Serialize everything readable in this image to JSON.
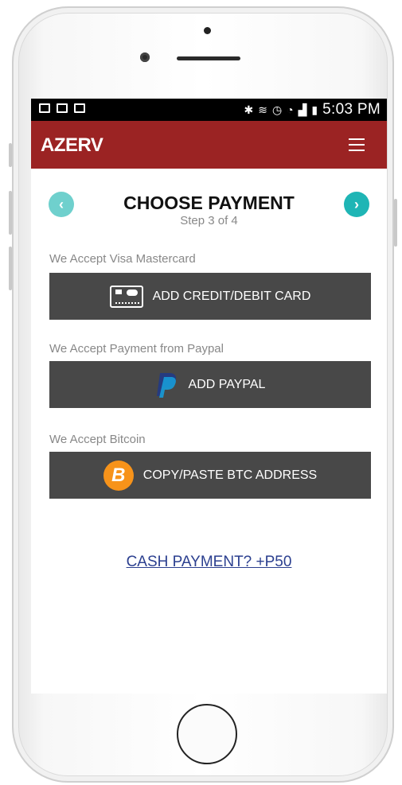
{
  "status_bar": {
    "left_icons": [
      "gallery-icon",
      "mail-icon",
      "mail-icon"
    ],
    "right_icons": [
      "bluetooth-icon",
      "vibrate-icon",
      "alarm-icon",
      "wifi-icon",
      "signal-icon",
      "battery-icon"
    ],
    "time": "5:03 PM"
  },
  "app_bar": {
    "brand": "AZERV",
    "menu_icon": "hamburger-menu-icon"
  },
  "header": {
    "title": "CHOOSE PAYMENT",
    "step": "Step 3 of 4",
    "prev_icon": "chevron-left-icon",
    "next_icon": "chevron-right-icon",
    "prev_glyph": "‹",
    "next_glyph": "›"
  },
  "options": [
    {
      "caption": "We Accept Visa Mastercard",
      "label": "ADD CREDIT/DEBIT CARD",
      "icon": "credit-card-icon"
    },
    {
      "caption": "We Accept Payment from Paypal",
      "label": "ADD PAYPAL",
      "icon": "paypal-icon"
    },
    {
      "caption": "We Accept Bitcoin",
      "label": "COPY/PASTE BTC ADDRESS",
      "icon": "bitcoin-icon",
      "icon_glyph": "B"
    }
  ],
  "cash_link": "CASH PAYMENT? +P50",
  "colors": {
    "app_bar": "#9b2323",
    "button": "#484848",
    "nav_prev": "#6fd0cd",
    "nav_next": "#1fb5b5",
    "bitcoin": "#f7931a",
    "paypal_dark": "#253b80",
    "paypal_light": "#179bd7",
    "link": "#2b3f8f"
  }
}
